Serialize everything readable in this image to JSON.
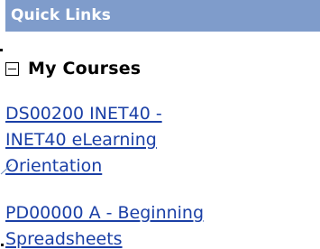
{
  "panel": {
    "header_title": "Quick Links"
  },
  "my_courses": {
    "title": "My Courses",
    "toggle_state": "expanded",
    "links": [
      {
        "lines": [
          "DS00200 INET40 -",
          "INET40 eLearning",
          "Orientation"
        ]
      },
      {
        "lines": [
          "PD00000 A - Beginning",
          "Spreadsheets"
        ]
      }
    ]
  },
  "colors": {
    "header_bg": "#7f9ccb",
    "header_text": "#ffffff",
    "link": "#1a3fa6"
  }
}
